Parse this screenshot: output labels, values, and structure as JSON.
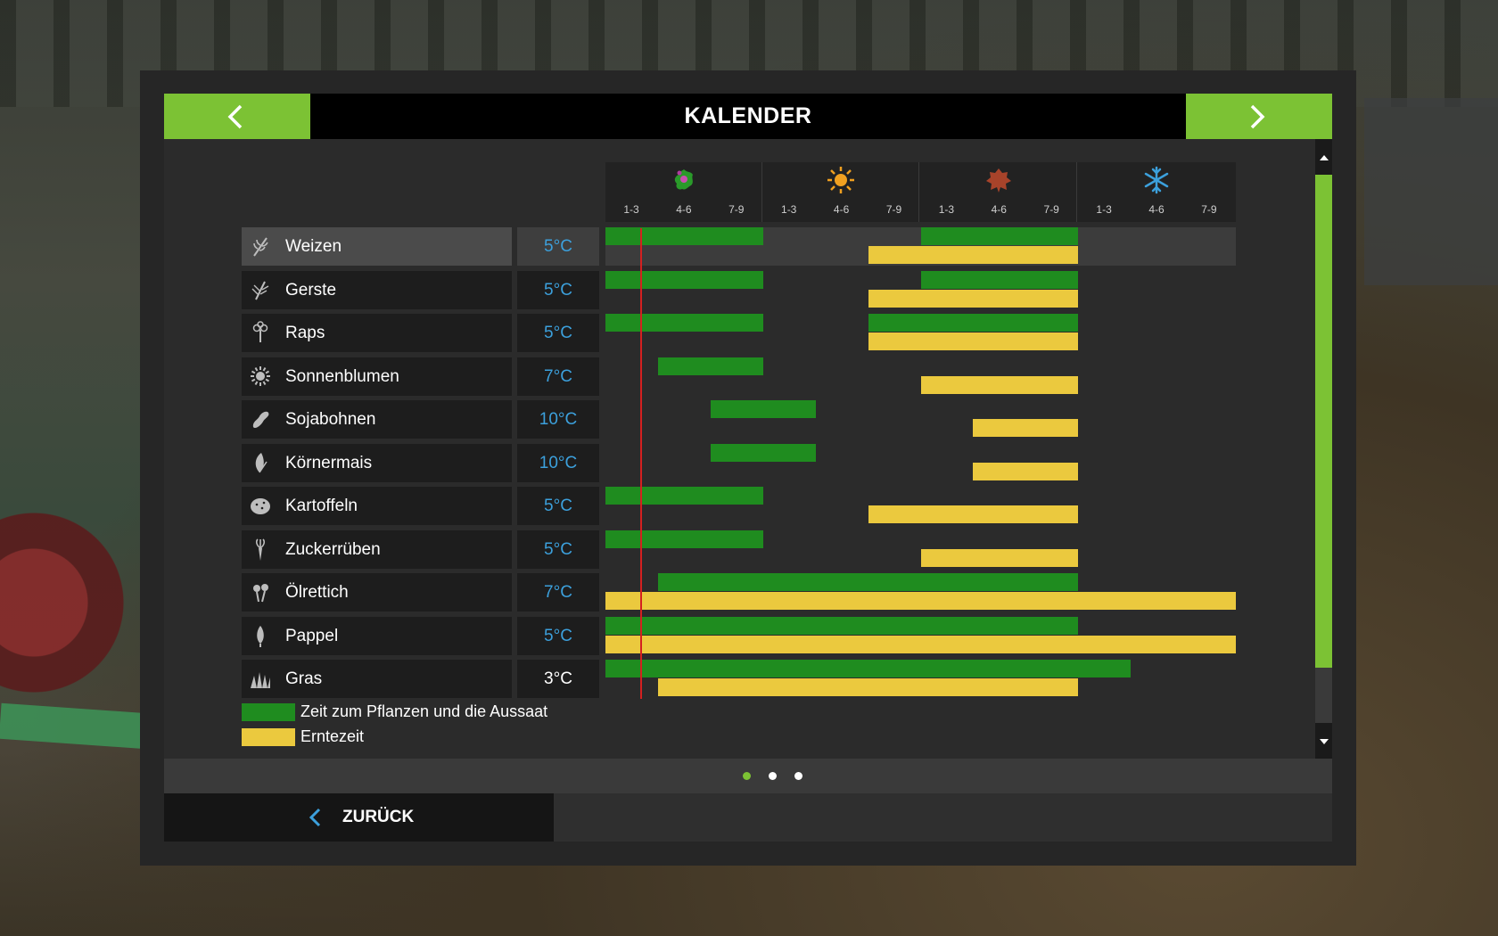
{
  "header": {
    "title": "KALENDER",
    "prev_icon": "chevron-left-icon",
    "next_icon": "chevron-right-icon"
  },
  "colors": {
    "accent": "#7cc234",
    "sowing": "#1f8c1f",
    "harvest": "#ebc93e",
    "temperature": "#3ca0dc",
    "today_line": "#d42020"
  },
  "calendar": {
    "seasons": [
      {
        "icon": "flower-spring-icon"
      },
      {
        "icon": "sun-summer-icon"
      },
      {
        "icon": "leaf-autumn-icon"
      },
      {
        "icon": "snowflake-winter-icon"
      }
    ],
    "ticks": [
      "1-3",
      "4-6",
      "7-9",
      "1-3",
      "4-6",
      "7-9",
      "1-3",
      "4-6",
      "7-9",
      "1-3",
      "4-6",
      "7-9"
    ],
    "today_position": 0.1,
    "crops": [
      {
        "name": "Weizen",
        "icon": "wheat-icon",
        "temp": "5°C",
        "selected": true,
        "sowing": [
          [
            0,
            3
          ],
          [
            6,
            9
          ]
        ],
        "harvest": [
          [
            5,
            9
          ]
        ]
      },
      {
        "name": "Gerste",
        "icon": "barley-icon",
        "temp": "5°C",
        "sowing": [
          [
            0,
            3
          ],
          [
            6,
            9
          ]
        ],
        "harvest": [
          [
            5,
            9
          ]
        ]
      },
      {
        "name": "Raps",
        "icon": "canola-icon",
        "temp": "5°C",
        "sowing": [
          [
            0,
            3
          ],
          [
            5,
            9
          ]
        ],
        "harvest": [
          [
            5,
            9
          ]
        ]
      },
      {
        "name": "Sonnenblumen",
        "icon": "sunflower-icon",
        "temp": "7°C",
        "sowing": [
          [
            1,
            3
          ]
        ],
        "harvest": [
          [
            6,
            9
          ]
        ]
      },
      {
        "name": "Sojabohnen",
        "icon": "soybean-icon",
        "temp": "10°C",
        "sowing": [
          [
            2,
            4
          ]
        ],
        "harvest": [
          [
            7,
            9
          ]
        ]
      },
      {
        "name": "Körnermais",
        "icon": "corn-icon",
        "temp": "10°C",
        "sowing": [
          [
            2,
            4
          ]
        ],
        "harvest": [
          [
            7,
            9
          ]
        ]
      },
      {
        "name": "Kartoffeln",
        "icon": "potato-icon",
        "temp": "5°C",
        "sowing": [
          [
            0,
            3
          ]
        ],
        "harvest": [
          [
            5,
            9
          ]
        ]
      },
      {
        "name": "Zuckerrüben",
        "icon": "sugarbeet-icon",
        "temp": "5°C",
        "sowing": [
          [
            0,
            3
          ]
        ],
        "harvest": [
          [
            6,
            9
          ]
        ]
      },
      {
        "name": "Ölrettich",
        "icon": "oilradish-icon",
        "temp": "7°C",
        "sowing": [
          [
            1,
            9
          ]
        ],
        "harvest": [
          [
            0,
            12
          ]
        ]
      },
      {
        "name": "Pappel",
        "icon": "poplar-icon",
        "temp": "5°C",
        "sowing": [
          [
            0,
            9
          ]
        ],
        "harvest": [
          [
            0,
            12
          ]
        ]
      },
      {
        "name": "Gras",
        "icon": "grass-icon",
        "temp": "3°C",
        "temp_white": true,
        "sowing": [
          [
            0,
            10
          ]
        ],
        "harvest": [
          [
            1,
            9
          ]
        ]
      }
    ]
  },
  "legend": {
    "sowing_label": "Zeit zum Pflanzen und die Aussaat",
    "harvest_label": "Erntezeit"
  },
  "pager": {
    "pages": 3,
    "active": 0
  },
  "footer": {
    "back_label": "ZURÜCK",
    "back_icon": "chevron-left-icon"
  }
}
